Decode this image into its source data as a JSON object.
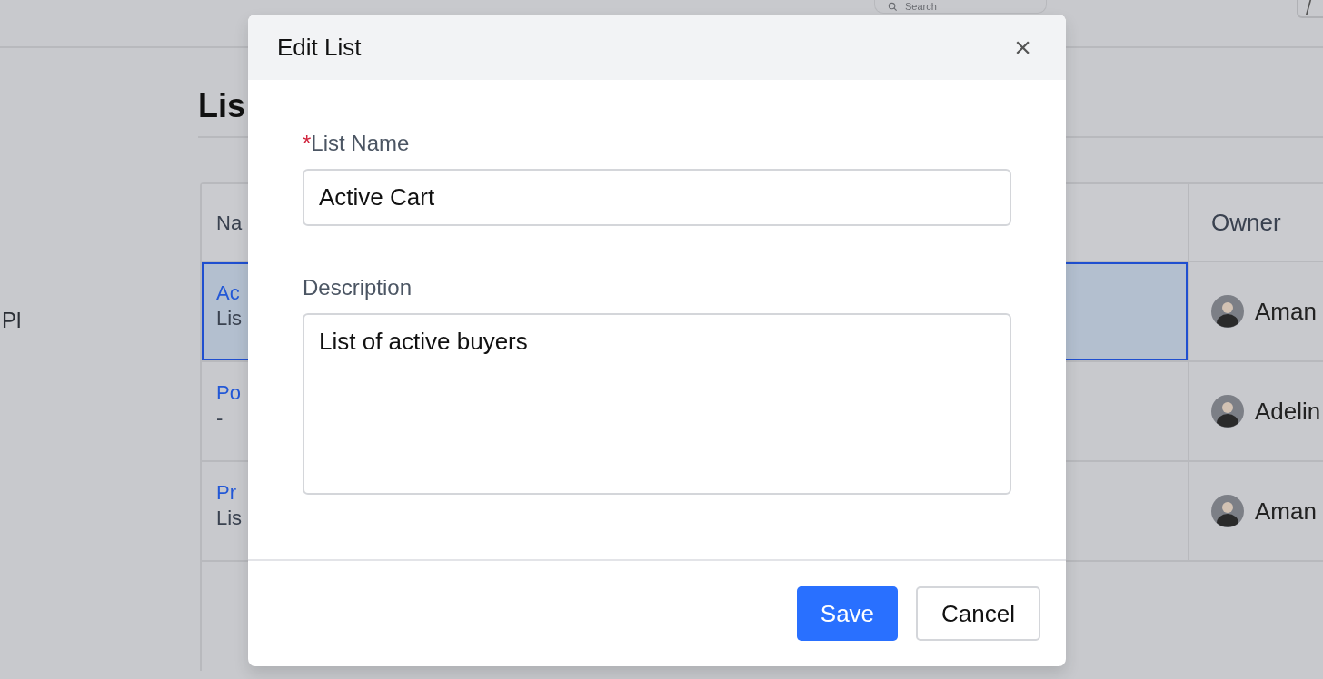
{
  "top_bar": {
    "search": {
      "placeholder": "Search"
    },
    "shortcut_key": "/"
  },
  "sidebar": {
    "items": [
      {
        "label": "Pl"
      }
    ]
  },
  "page": {
    "title": "Lis"
  },
  "table": {
    "columns": [
      "Na",
      "Owner"
    ],
    "rows": [
      {
        "name": "Ac",
        "description": "Lis",
        "owner": "Aman",
        "selected": true
      },
      {
        "name": "Po",
        "description": "-",
        "owner": "Adelin",
        "selected": false
      },
      {
        "name": "Pr",
        "description": "Lis",
        "owner": "Aman",
        "selected": false
      }
    ]
  },
  "dialog": {
    "title": "Edit List",
    "close": "×",
    "fields": [
      {
        "kind": "input",
        "label": "List Name",
        "required": true,
        "required_mark": "*",
        "value": "Active Cart"
      },
      {
        "kind": "textarea",
        "label": "Description",
        "required": false,
        "value": "List of active buyers"
      }
    ],
    "buttons": [
      {
        "label": "Save",
        "kind": "primary"
      },
      {
        "label": "Cancel",
        "kind": "secondary"
      }
    ]
  }
}
